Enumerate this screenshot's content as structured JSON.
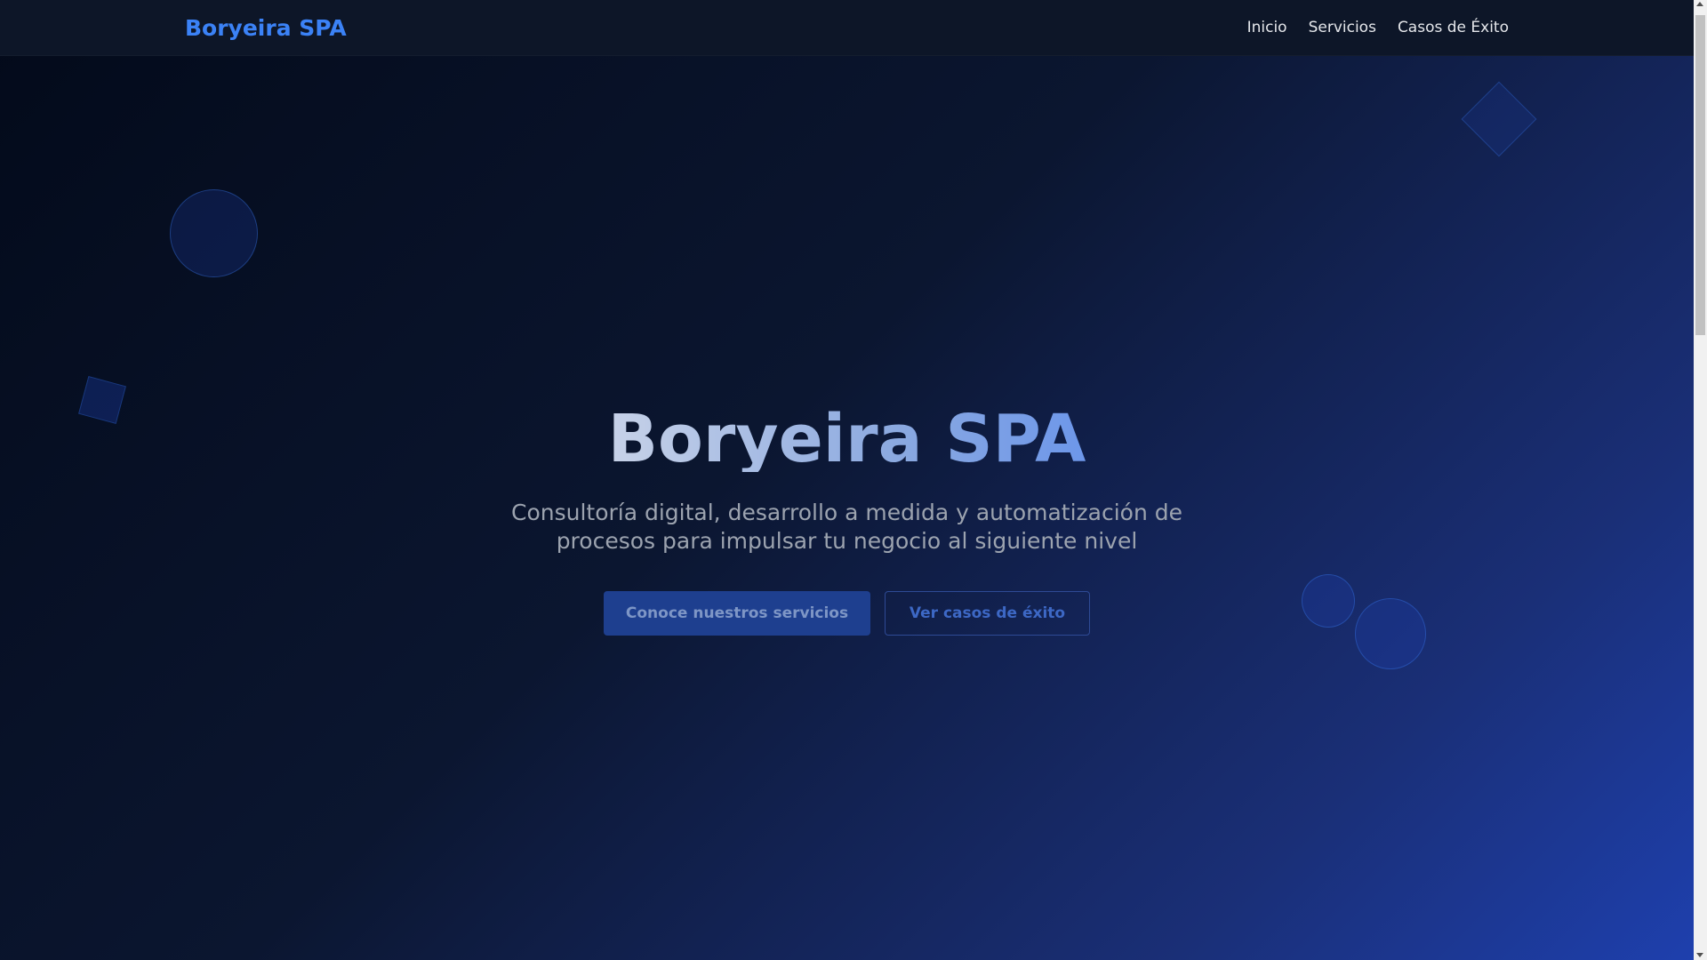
{
  "navbar": {
    "brand": "Boryeira SPA",
    "links": [
      {
        "label": "Inicio"
      },
      {
        "label": "Servicios"
      },
      {
        "label": "Casos de Éxito"
      }
    ]
  },
  "hero": {
    "title": "Boryeira SPA",
    "subtitle": "Consultoría digital, desarrollo a medida y automatización de procesos para impulsar tu negocio al siguiente nivel",
    "primary_cta": "Conoce nuestros servicios",
    "secondary_cta": "Ver casos de éxito"
  },
  "colors": {
    "brand": "#3b82f6",
    "navbar_bg": "#0d1628",
    "primary_button": "#1e3f8f",
    "background_dark": "#030a1a",
    "background_accent": "#1e40af"
  },
  "icons": {
    "scroll_up": "chevron-up-icon",
    "scroll_down": "chevron-down-icon"
  }
}
